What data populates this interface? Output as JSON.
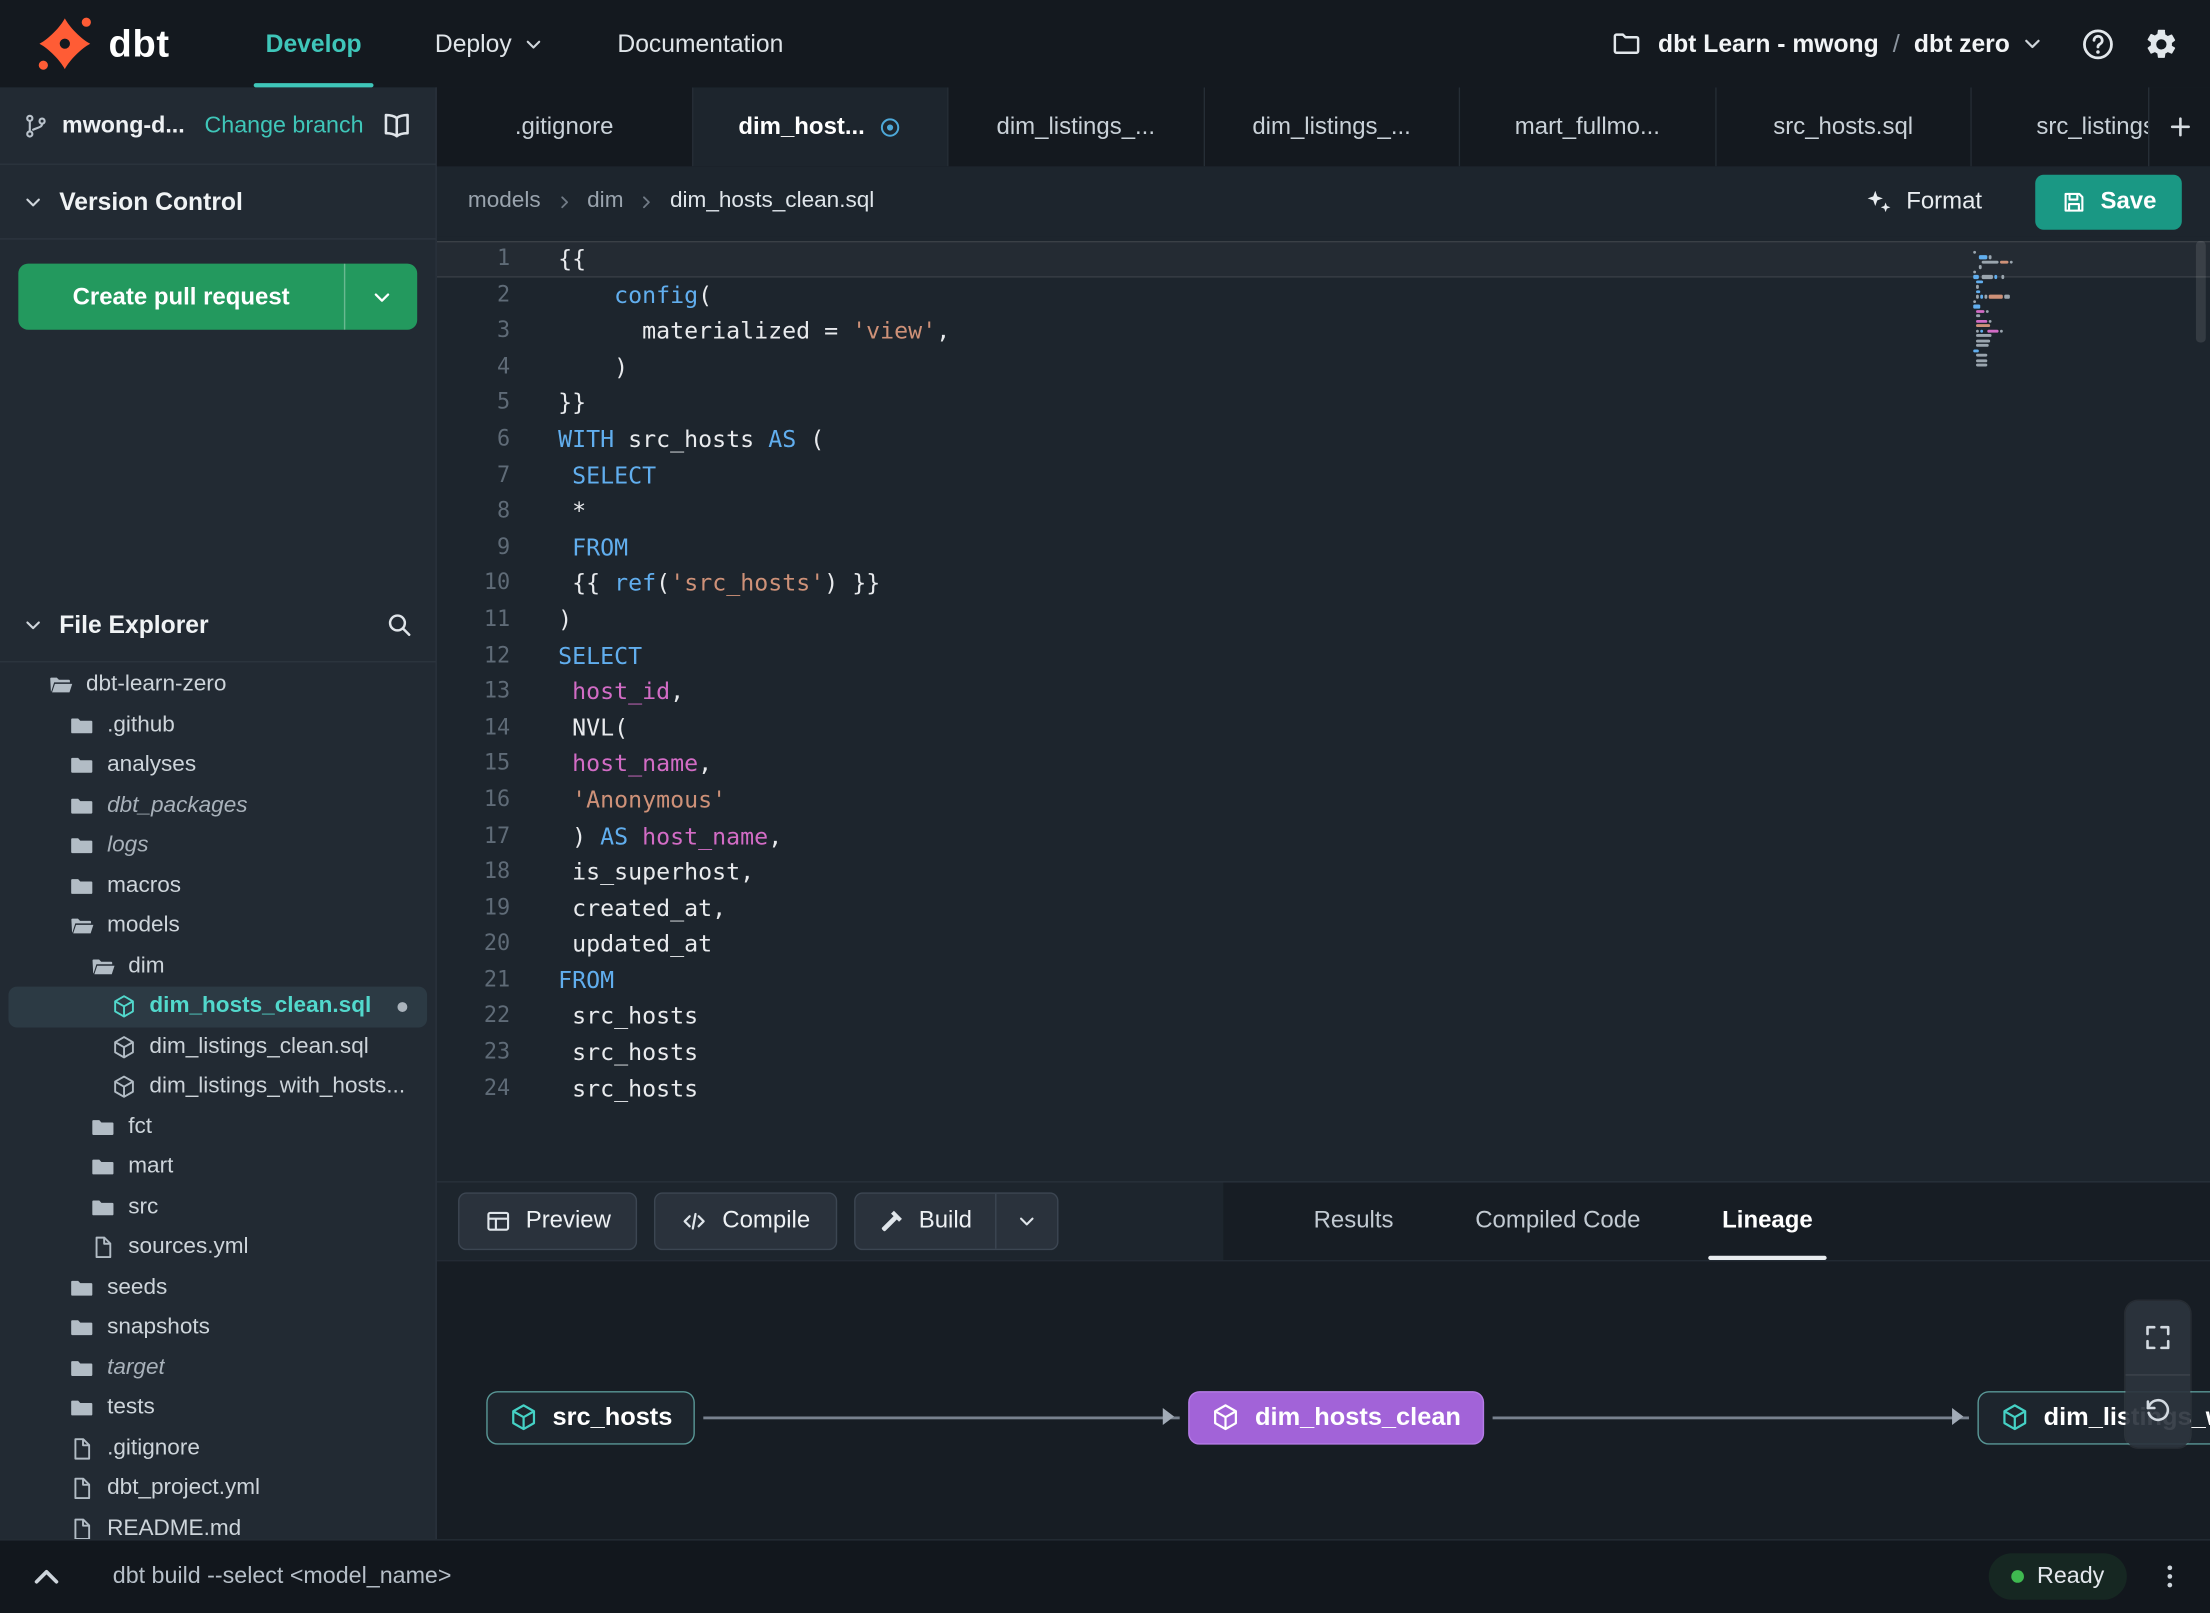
{
  "topnav": {
    "brand": "dbt",
    "menu": [
      {
        "label": "Develop",
        "active": true
      },
      {
        "label": "Deploy",
        "chevron": true
      },
      {
        "label": "Documentation"
      }
    ],
    "project": "dbt Learn - mwong",
    "separator": "/",
    "environment": "dbt zero"
  },
  "sidebar": {
    "branch_name": "mwong-d...",
    "change_branch_label": "Change branch",
    "version_control_label": "Version Control",
    "create_pr_label": "Create pull request",
    "file_explorer_label": "File Explorer",
    "file_tree": [
      {
        "label": "dbt-learn-zero",
        "type": "folder-open",
        "level": 0
      },
      {
        "label": ".github",
        "type": "folder",
        "level": 1
      },
      {
        "label": "analyses",
        "type": "folder",
        "level": 1
      },
      {
        "label": "dbt_packages",
        "type": "folder",
        "level": 1,
        "italic": true
      },
      {
        "label": "logs",
        "type": "folder",
        "level": 1,
        "italic": true
      },
      {
        "label": "macros",
        "type": "folder",
        "level": 1
      },
      {
        "label": "models",
        "type": "folder-open",
        "level": 1
      },
      {
        "label": "dim",
        "type": "folder-open",
        "level": 2
      },
      {
        "label": "dim_hosts_clean.sql",
        "type": "model",
        "level": 3,
        "selected": true,
        "modified": true
      },
      {
        "label": "dim_listings_clean.sql",
        "type": "model",
        "level": 3
      },
      {
        "label": "dim_listings_with_hosts...",
        "type": "model",
        "level": 3
      },
      {
        "label": "fct",
        "type": "folder",
        "level": 2
      },
      {
        "label": "mart",
        "type": "folder",
        "level": 2
      },
      {
        "label": "src",
        "type": "folder",
        "level": 2
      },
      {
        "label": "sources.yml",
        "type": "file",
        "level": 2
      },
      {
        "label": "seeds",
        "type": "folder",
        "level": 1
      },
      {
        "label": "snapshots",
        "type": "folder",
        "level": 1
      },
      {
        "label": "target",
        "type": "folder",
        "level": 1,
        "italic": true
      },
      {
        "label": "tests",
        "type": "folder",
        "level": 1
      },
      {
        "label": ".gitignore",
        "type": "file",
        "level": 1
      },
      {
        "label": "dbt_project.yml",
        "type": "file",
        "level": 1
      },
      {
        "label": "README.md",
        "type": "file",
        "level": 1
      }
    ]
  },
  "tabbar": {
    "tabs": [
      {
        "label": ".gitignore"
      },
      {
        "label": "dim_host...",
        "active": true,
        "modified": true
      },
      {
        "label": "dim_listings_..."
      },
      {
        "label": "dim_listings_..."
      },
      {
        "label": "mart_fullmo..."
      },
      {
        "label": "src_hosts.sql"
      },
      {
        "label": "src_listings."
      }
    ]
  },
  "breadcrumb": {
    "path": [
      "models",
      "dim",
      "dim_hosts_clean.sql"
    ]
  },
  "editor_header": {
    "format_label": "Format",
    "save_label": "Save"
  },
  "editor": {
    "language": "sql",
    "cursor_line": 1,
    "lines": [
      [
        [
          "p",
          "{{"
        ]
      ],
      [
        [
          "p",
          "    "
        ],
        [
          "fn",
          "config"
        ],
        [
          "p",
          "("
        ]
      ],
      [
        [
          "p",
          "      materialized = "
        ],
        [
          "str",
          "'view'"
        ],
        [
          "p",
          ","
        ]
      ],
      [
        [
          "p",
          "    )"
        ]
      ],
      [
        [
          "p",
          "}}"
        ]
      ],
      [
        [
          "kw",
          "WITH"
        ],
        [
          "p",
          " src_hosts "
        ],
        [
          "kw",
          "AS"
        ],
        [
          "p",
          " ("
        ]
      ],
      [
        [
          "p",
          " "
        ],
        [
          "kw",
          "SELECT"
        ]
      ],
      [
        [
          "p",
          " *"
        ]
      ],
      [
        [
          "p",
          " "
        ],
        [
          "kw",
          "FROM"
        ]
      ],
      [
        [
          "p",
          " {{ "
        ],
        [
          "fn",
          "ref"
        ],
        [
          "p",
          "("
        ],
        [
          "str",
          "'src_hosts'"
        ],
        [
          "p",
          ") }}"
        ]
      ],
      [
        [
          "p",
          ")"
        ]
      ],
      [
        [
          "kw",
          "SELECT"
        ]
      ],
      [
        [
          "p",
          " "
        ],
        [
          "id",
          "host_id"
        ],
        [
          "p",
          ","
        ]
      ],
      [
        [
          "p",
          " NVL("
        ]
      ],
      [
        [
          "p",
          " "
        ],
        [
          "id",
          "host_name"
        ],
        [
          "p",
          ","
        ]
      ],
      [
        [
          "p",
          " "
        ],
        [
          "str",
          "'Anonymous'"
        ]
      ],
      [
        [
          "p",
          " ) "
        ],
        [
          "kw",
          "AS"
        ],
        [
          "p",
          " "
        ],
        [
          "id",
          "host_name"
        ],
        [
          "p",
          ","
        ]
      ],
      [
        [
          "p",
          " is_superhost,"
        ]
      ],
      [
        [
          "p",
          " created_at,"
        ]
      ],
      [
        [
          "p",
          " updated_at"
        ]
      ],
      [
        [
          "kw",
          "FROM"
        ]
      ],
      [
        [
          "p",
          " src_hosts"
        ]
      ],
      [
        [
          "p",
          " src_hosts"
        ]
      ],
      [
        [
          "p",
          " src_hosts"
        ]
      ]
    ]
  },
  "bottom_toolbar": {
    "preview_label": "Preview",
    "compile_label": "Compile",
    "build_label": "Build",
    "tabs": [
      {
        "label": "Results"
      },
      {
        "label": "Compiled Code"
      },
      {
        "label": "Lineage",
        "active": true
      }
    ]
  },
  "lineage": {
    "nodes": [
      {
        "label": "src_hosts",
        "variant": "teal"
      },
      {
        "label": "dim_hosts_clean",
        "variant": "purple",
        "selected": true
      },
      {
        "label": "dim_listings_with_hosts",
        "variant": "teal",
        "clipped": true
      }
    ]
  },
  "statusbar": {
    "command": "dbt build --select <model_name>",
    "status_label": "Ready"
  },
  "colors": {
    "accent_teal": "#3fc6b9",
    "brand_orange": "#ff5c35",
    "pr_green": "#23995e",
    "save_teal": "#1a9884",
    "node_purple": "#a263d8",
    "status_green": "#3fb950"
  }
}
